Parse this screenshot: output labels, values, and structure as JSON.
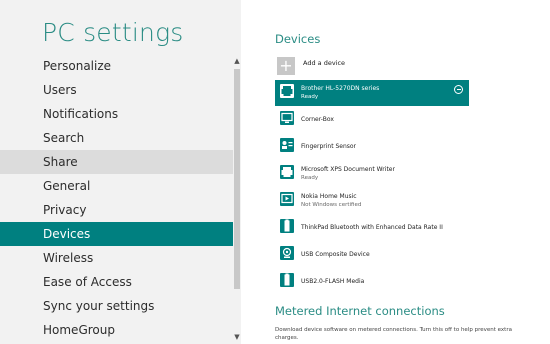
{
  "app": {
    "title": "PC settings"
  },
  "nav": {
    "items": [
      {
        "label": "Personalize",
        "state": ""
      },
      {
        "label": "Users",
        "state": ""
      },
      {
        "label": "Notifications",
        "state": ""
      },
      {
        "label": "Search",
        "state": ""
      },
      {
        "label": "Share",
        "state": "hover"
      },
      {
        "label": "General",
        "state": ""
      },
      {
        "label": "Privacy",
        "state": ""
      },
      {
        "label": "Devices",
        "state": "active"
      },
      {
        "label": "Wireless",
        "state": ""
      },
      {
        "label": "Ease of Access",
        "state": ""
      },
      {
        "label": "Sync your settings",
        "state": ""
      },
      {
        "label": "HomeGroup",
        "state": ""
      }
    ]
  },
  "devices_section": {
    "title": "Devices",
    "add_label": "Add a device",
    "items": [
      {
        "name": "Brother HL-5270DN series",
        "status": "Ready",
        "icon": "printer-icon",
        "selected": true
      },
      {
        "name": "Corner-Box",
        "status": "",
        "icon": "monitor-icon",
        "selected": false
      },
      {
        "name": "Fingerprint Sensor",
        "status": "",
        "icon": "fingerprint-sensor-icon",
        "selected": false
      },
      {
        "name": "Microsoft XPS Document Writer",
        "status": "Ready",
        "icon": "printer-icon",
        "selected": false
      },
      {
        "name": "Nokia Home Music",
        "status": "Not Windows certified",
        "icon": "media-player-icon",
        "selected": false
      },
      {
        "name": "ThinkPad Bluetooth with Enhanced Data Rate II",
        "status": "",
        "icon": "usb-drive-icon",
        "selected": false
      },
      {
        "name": "USB Composite Device",
        "status": "",
        "icon": "webcam-icon",
        "selected": false
      },
      {
        "name": "USB2.0-FLASH Media",
        "status": "",
        "icon": "usb-drive-icon",
        "selected": false
      }
    ]
  },
  "metered_section": {
    "title": "Metered Internet connections",
    "description": "Download device software on metered connections. Turn this off to help prevent extra charges."
  },
  "colors": {
    "accent": "#008080",
    "title": "#2a8c84",
    "left_bg": "#f2f2f2",
    "hover": "#dcdcdc"
  }
}
